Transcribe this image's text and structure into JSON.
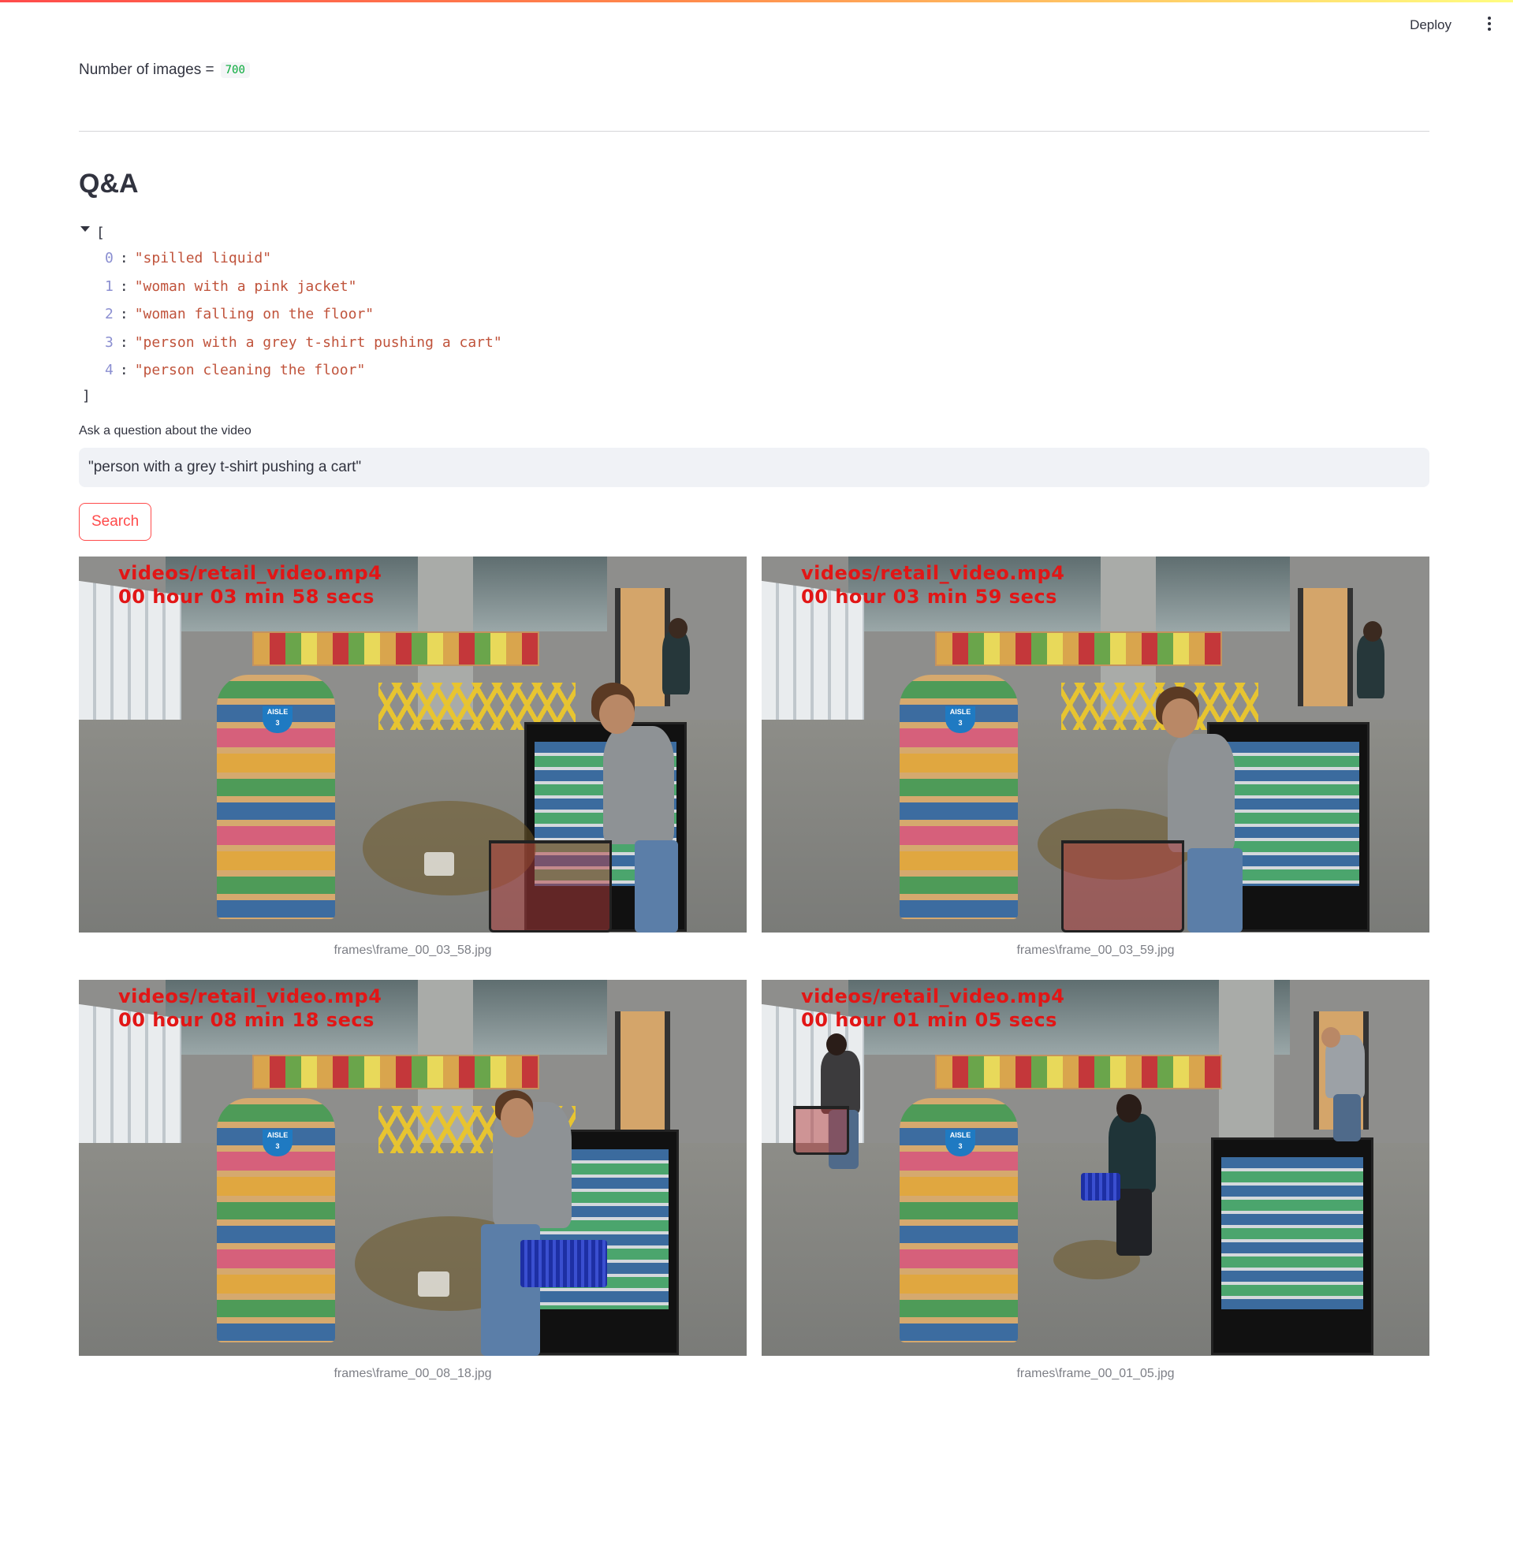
{
  "header": {
    "deploy_label": "Deploy",
    "menu_icon": "kebab-menu-icon"
  },
  "stats": {
    "label": "Number of images =",
    "value": "700"
  },
  "qa": {
    "title": "Q&A",
    "json_open": "[",
    "json_close": "]",
    "examples": [
      {
        "index": "0",
        "text": "\"spilled liquid\""
      },
      {
        "index": "1",
        "text": "\"woman with a pink jacket\""
      },
      {
        "index": "2",
        "text": "\"woman falling on the floor\""
      },
      {
        "index": "3",
        "text": "\"person with a grey t-shirt pushing a cart\""
      },
      {
        "index": "4",
        "text": "\"person cleaning the floor\""
      }
    ],
    "input_label": "Ask a question about the video",
    "input_value": "\"person with a grey t-shirt pushing a cart\"",
    "search_label": "Search"
  },
  "results": [
    {
      "video": "videos/retail_video.mp4",
      "timestamp": "00 hour 03 min 58 secs",
      "caption": "frames\\frame_00_03_58.jpg"
    },
    {
      "video": "videos/retail_video.mp4",
      "timestamp": "00 hour 03 min 59 secs",
      "caption": "frames\\frame_00_03_59.jpg"
    },
    {
      "video": "videos/retail_video.mp4",
      "timestamp": "00 hour 08 min 18 secs",
      "caption": "frames\\frame_00_08_18.jpg"
    },
    {
      "video": "videos/retail_video.mp4",
      "timestamp": "00 hour 01 min 05 secs",
      "caption": "frames\\frame_00_01_05.jpg"
    }
  ],
  "colors": {
    "accent": "#ff4b4b",
    "code_green": "#09ab3b",
    "json_string": "#c0533b",
    "json_index": "#8b8fd1",
    "overlay_red": "#e21616"
  }
}
